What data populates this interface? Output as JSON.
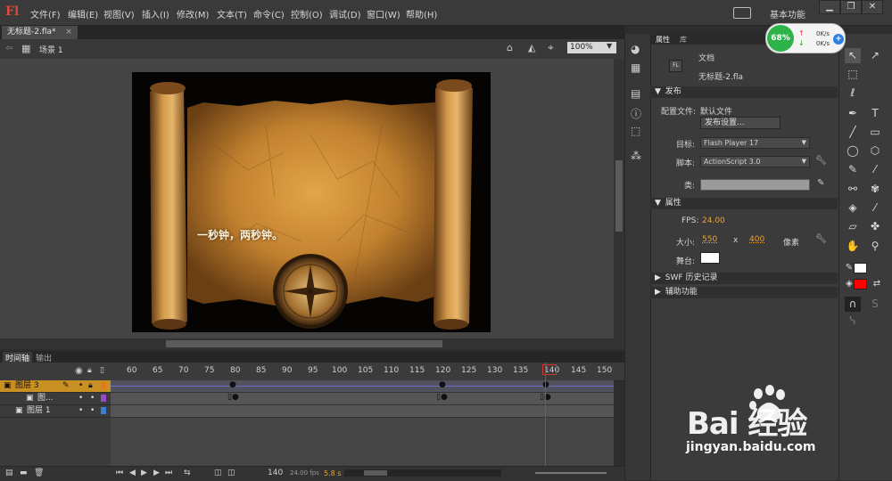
{
  "app": {
    "logo": "Fl"
  },
  "menu": [
    "文件(F)",
    "编辑(E)",
    "视图(V)",
    "插入(I)",
    "修改(M)",
    "文本(T)",
    "命令(C)",
    "控制(O)",
    "调试(D)",
    "窗口(W)",
    "帮助(H)"
  ],
  "workspace": "基本功能",
  "window_controls": {
    "minimize": "▁",
    "restore": "❐",
    "close": "✕"
  },
  "document": {
    "tab": "无标题-2.fla*",
    "scene": "场景 1",
    "zoom": "100%"
  },
  "stage": {
    "caption": "一秒钟，两秒钟。"
  },
  "timeline": {
    "tabs": [
      "时间轴",
      "输出"
    ],
    "ticks": [
      "60",
      "65",
      "70",
      "75",
      "80",
      "85",
      "90",
      "95",
      "100",
      "105",
      "110",
      "115",
      "120",
      "125",
      "130",
      "135",
      "140",
      "145",
      "150"
    ],
    "layers": [
      {
        "name": "图层 3",
        "selected": true,
        "color": "#e07a1a"
      },
      {
        "name": "图...",
        "selected": false,
        "color": "#9a49c9"
      },
      {
        "name": "图层 1",
        "selected": false,
        "color": "#3a7fd0"
      }
    ],
    "current_frame": "140",
    "fps": "24.00 fps",
    "time": "5.8 s"
  },
  "panel": {
    "tabs": [
      "属性",
      "库"
    ],
    "doc_label": "文档",
    "doc_icon": "FL",
    "file_name": "无标题-2.fla",
    "publish_head": "发布",
    "profile_label": "配置文件:",
    "profile_value": "默认文件",
    "publish_settings": "发布设置...",
    "target_label": "目标:",
    "target_value": "Flash Player 17",
    "script_label": "脚本:",
    "script_value": "ActionScript 3.0",
    "class_label": "类:",
    "props_head": "属性",
    "fps_label": "FPS:",
    "fps_value": "24.00",
    "size_label": "大小:",
    "width": "550",
    "x": "x",
    "height": "400",
    "unit": "像素",
    "stage_label": "舞台:",
    "swf_head": "SWF 历史记录",
    "access_head": "辅助功能"
  },
  "network": {
    "cpu": "68%",
    "up": "0K/s",
    "down": "0K/s"
  },
  "watermark": {
    "logo": "Bai 经验",
    "url": "jingyan.baidu.com"
  }
}
